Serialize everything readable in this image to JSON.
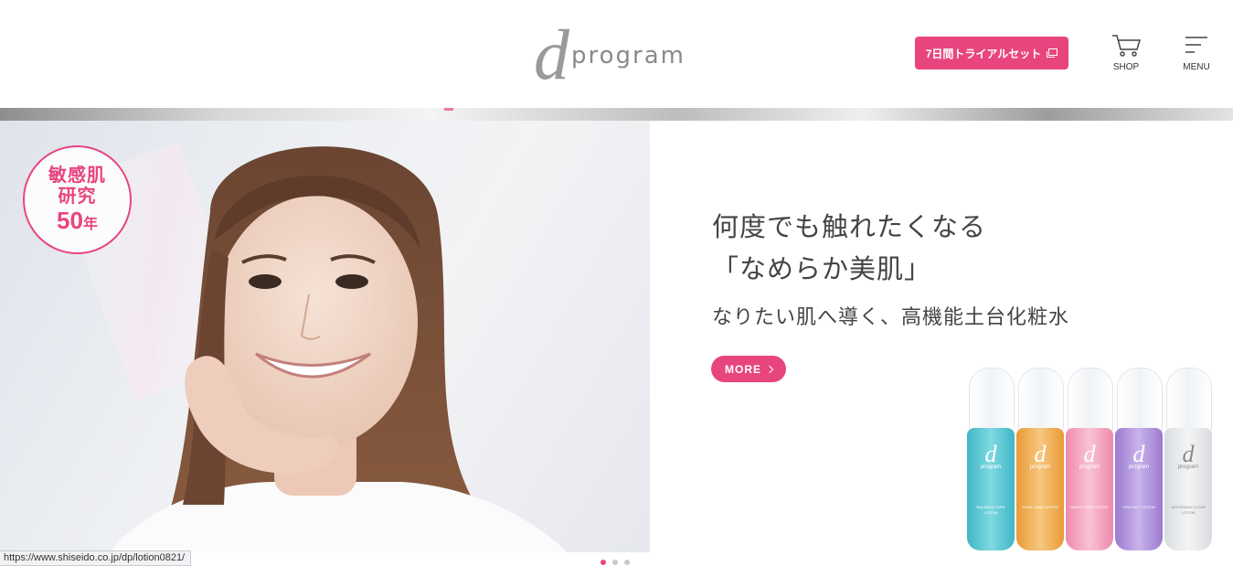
{
  "brand": {
    "logo_mark": "d",
    "logo_word": "program"
  },
  "header": {
    "trial_button": "7日間トライアルセット",
    "shop_label": "SHOP",
    "menu_label": "MENU"
  },
  "hero": {
    "badge": {
      "line1": "敏感肌",
      "line2": "研究",
      "line3_num": "50",
      "line3_unit": "年"
    },
    "title_line1": "何度でも触れたくなる",
    "title_line2": "「なめらか美肌」",
    "subtitle": "なりたい肌へ導く、高機能土台化粧水",
    "more_label": "MORE"
  },
  "products": [
    {
      "mark": "d",
      "word": "program",
      "label": "BALANCE CARE LOTION",
      "color": "#4fc3d0"
    },
    {
      "mark": "d",
      "word": "program",
      "label": "ACNE CARE LOTION",
      "color": "#f0a94a"
    },
    {
      "mark": "d",
      "word": "program",
      "label": "MOIST CARE LOTION",
      "color": "#f29bb8"
    },
    {
      "mark": "d",
      "word": "program",
      "label": "VITAL ACT LOTION",
      "color": "#a889d6"
    },
    {
      "mark": "d",
      "word": "program",
      "label": "WHITENING CLEAR LOTION",
      "color": "#e2e4e6"
    }
  ],
  "carousel": {
    "count": 3,
    "active": 1
  },
  "status_url": "https://www.shiseido.co.jp/dp/lotion0821/",
  "colors": {
    "accent": "#e8457f",
    "text": "#444444"
  }
}
